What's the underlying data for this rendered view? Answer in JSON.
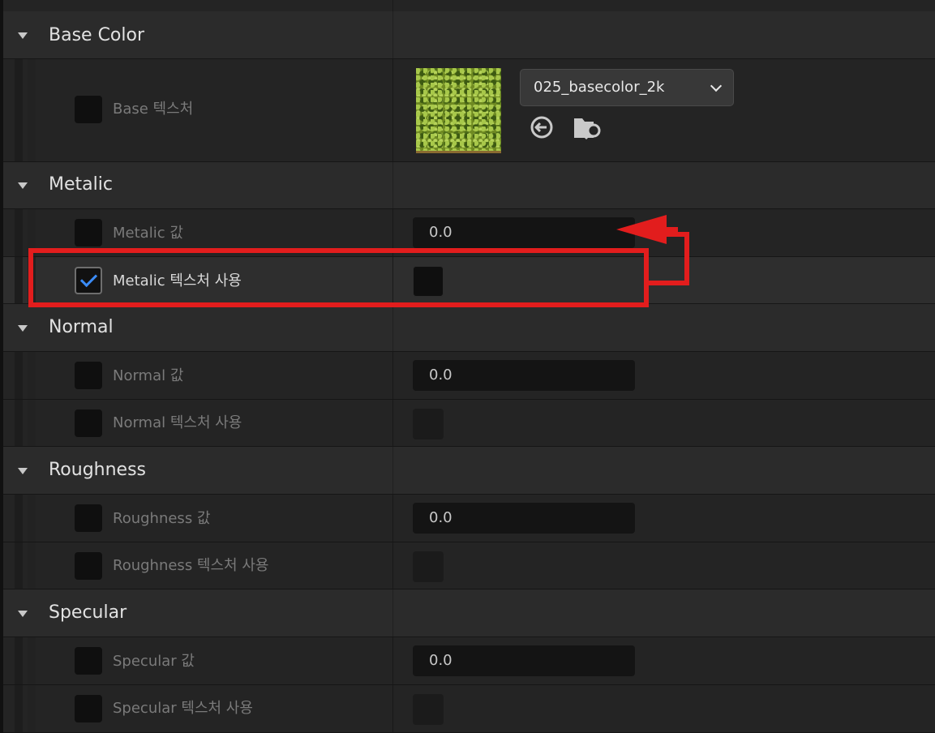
{
  "categories": {
    "base_color": "Base Color",
    "metalic": "Metalic",
    "normal": "Normal",
    "roughness": "Roughness",
    "specular": "Specular"
  },
  "properties": {
    "base_texture_label": "Base 텍스처",
    "base_texture_asset": "025_basecolor_2k",
    "metalic_value_label": "Metalic 값",
    "metalic_value": "0.0",
    "metalic_use_texture_label": "Metalic 텍스처 사용",
    "normal_value_label": "Normal 값",
    "normal_value": "0.0",
    "normal_use_texture_label": "Normal 텍스처 사용",
    "roughness_value_label": "Roughness 값",
    "roughness_value": "0.0",
    "roughness_use_texture_label": "Roughness 텍스처 사용",
    "specular_value_label": "Specular 값",
    "specular_value": "0.0",
    "specular_use_texture_label": "Specular 텍스처 사용"
  },
  "states": {
    "metalic_use_texture_checked": true
  },
  "icons": [
    "expand-caret-icon",
    "checkmark-icon",
    "use-selected-asset-icon",
    "browse-asset-icon"
  ],
  "colors": {
    "highlight_annotation": "#e21d1d",
    "checkmark": "#3b8cf7",
    "panel_bg": "#242424"
  }
}
